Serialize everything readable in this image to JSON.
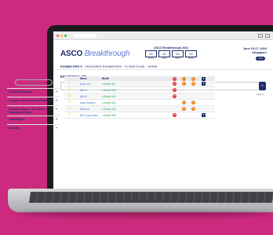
{
  "event": {
    "logo_main": "ASCO",
    "logo_accent": "Breakthrough",
    "countdown_title": "ASCO Breakthrough 2024",
    "countdown_values": [
      "00",
      "00",
      "00",
      "00"
    ],
    "countdown_units": [
      "DAYS",
      "HRS",
      "MINS",
      "SECS"
    ],
    "dates": "June 20-27, 2024",
    "location": "Singapore",
    "login_label": "Login"
  },
  "nav": {
    "items": [
      "EXHIBITORS ▾",
      "FEATURED EXHIBITORS",
      "FLOOR PLAN",
      "HOME"
    ]
  },
  "exhibitor_list": {
    "title": "EXHIBITOR LIST",
    "search_placeholder": "Search",
    "filter_label": "Filter ▾"
  },
  "sidebar": {
    "reset_label": "Favorites",
    "items": [
      {
        "label": "Featured Exhibitor",
        "marker": "+"
      },
      {
        "label": "Compare Cancer Council Member",
        "marker": "+"
      },
      {
        "label": "Compare Cancer: The ASCO Foundation Donor",
        "marker": "+"
      },
      {
        "label": "State/Region",
        "marker": "+"
      },
      {
        "label": "Country",
        "marker": "+"
      }
    ]
  },
  "table": {
    "headers": {
      "name": "Name",
      "booth": "Booth"
    },
    "rows": [
      {
        "name": "Abby, Inc.",
        "booth": "● Booth #01",
        "icons": [
          "red",
          "orange",
          "orange",
          "navy"
        ]
      },
      {
        "name": "AB-01",
        "booth": "● Booth #02",
        "icons": [
          "red"
        ]
      },
      {
        "name": "AB-02",
        "booth": "● Booth #03",
        "icons": [
          "red"
        ]
      },
      {
        "name": "Astra Science",
        "booth": "● Booth #04",
        "icons": [
          "orange",
          "orange"
        ]
      },
      {
        "name": "Biotrove",
        "booth": "● Booth #05",
        "icons": [
          "orange",
          "orange"
        ]
      },
      {
        "name": "BIO Corporation",
        "booth": "● Booth #06",
        "icons": [
          "red",
          "navy"
        ]
      }
    ]
  },
  "colors": {
    "background": "#cc2a7e",
    "brand_navy": "#1e2c6b",
    "link_blue": "#4a6fd1",
    "booth_green": "#2eaa4b",
    "star_yellow": "#f2c300"
  }
}
